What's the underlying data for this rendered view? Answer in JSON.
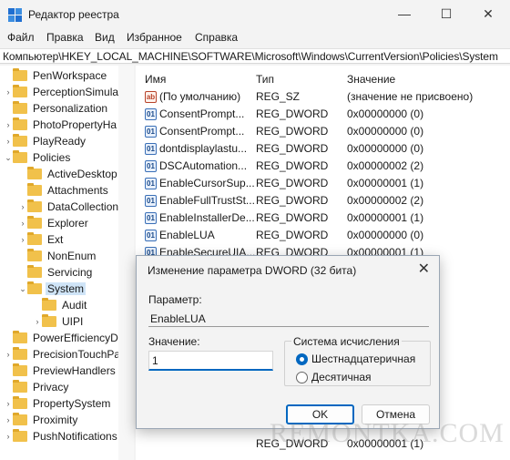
{
  "window": {
    "title": "Редактор реестра",
    "minimize": "—",
    "maximize": "☐",
    "close": "✕"
  },
  "menu": [
    "Файл",
    "Правка",
    "Вид",
    "Избранное",
    "Справка"
  ],
  "address": "Компьютер\\HKEY_LOCAL_MACHINE\\SOFTWARE\\Microsoft\\Windows\\CurrentVersion\\Policies\\System",
  "tree": [
    {
      "label": "PenWorkspace",
      "expander": ""
    },
    {
      "label": "PerceptionSimula",
      "expander": "›"
    },
    {
      "label": "Personalization",
      "expander": ""
    },
    {
      "label": "PhotoPropertyHa",
      "expander": "›"
    },
    {
      "label": "PlayReady",
      "expander": "›"
    },
    {
      "label": "Policies",
      "expander": "⌄"
    },
    {
      "label": "ActiveDesktop",
      "expander": ""
    },
    {
      "label": "Attachments",
      "expander": ""
    },
    {
      "label": "DataCollection",
      "expander": "›"
    },
    {
      "label": "Explorer",
      "expander": "›"
    },
    {
      "label": "Ext",
      "expander": "›"
    },
    {
      "label": "NonEnum",
      "expander": ""
    },
    {
      "label": "Servicing",
      "expander": ""
    },
    {
      "label": "System",
      "expander": "⌄"
    },
    {
      "label": "Audit",
      "expander": ""
    },
    {
      "label": "UIPI",
      "expander": "›"
    },
    {
      "label": "PowerEfficiencyD",
      "expander": ""
    },
    {
      "label": "PrecisionTouchPa",
      "expander": "›"
    },
    {
      "label": "PreviewHandlers",
      "expander": ""
    },
    {
      "label": "Privacy",
      "expander": ""
    },
    {
      "label": "PropertySystem",
      "expander": "›"
    },
    {
      "label": "Proximity",
      "expander": "›"
    },
    {
      "label": "PushNotifications",
      "expander": "›"
    }
  ],
  "columns": {
    "name": "Имя",
    "type": "Тип",
    "value": "Значение"
  },
  "values": [
    {
      "icon": "ab",
      "name": "(По умолчанию)",
      "type": "REG_SZ",
      "value": "(значение не присвоено)"
    },
    {
      "icon": "bin",
      "name": "ConsentPrompt...",
      "type": "REG_DWORD",
      "value": "0x00000000 (0)"
    },
    {
      "icon": "bin",
      "name": "ConsentPrompt...",
      "type": "REG_DWORD",
      "value": "0x00000000 (0)"
    },
    {
      "icon": "bin",
      "name": "dontdisplaylastu...",
      "type": "REG_DWORD",
      "value": "0x00000000 (0)"
    },
    {
      "icon": "bin",
      "name": "DSCAutomation...",
      "type": "REG_DWORD",
      "value": "0x00000002 (2)"
    },
    {
      "icon": "bin",
      "name": "EnableCursorSup...",
      "type": "REG_DWORD",
      "value": "0x00000001 (1)"
    },
    {
      "icon": "bin",
      "name": "EnableFullTrustSt...",
      "type": "REG_DWORD",
      "value": "0x00000002 (2)"
    },
    {
      "icon": "bin",
      "name": "EnableInstallerDe...",
      "type": "REG_DWORD",
      "value": "0x00000001 (1)"
    },
    {
      "icon": "bin",
      "name": "EnableLUA",
      "type": "REG_DWORD",
      "value": "0x00000000 (0)"
    },
    {
      "icon": "bin",
      "name": "EnableSecureUIA...",
      "type": "REG_DWORD",
      "value": "0x00000001 (1)"
    }
  ],
  "dialog": {
    "title": "Изменение параметра DWORD (32 бита)",
    "close": "✕",
    "name_label": "Параметр:",
    "name_value": "EnableLUA",
    "value_label": "Значение:",
    "value_input": "1",
    "base_label": "Система исчисления",
    "hex_label": "Шестнадцатеричная",
    "dec_label": "Десятичная",
    "ok": "OK",
    "cancel": "Отмена"
  },
  "partial_row": {
    "type": "REG_DWORD",
    "value": "0x00000001 (1)"
  },
  "watermark": "REMONTKA.COM"
}
